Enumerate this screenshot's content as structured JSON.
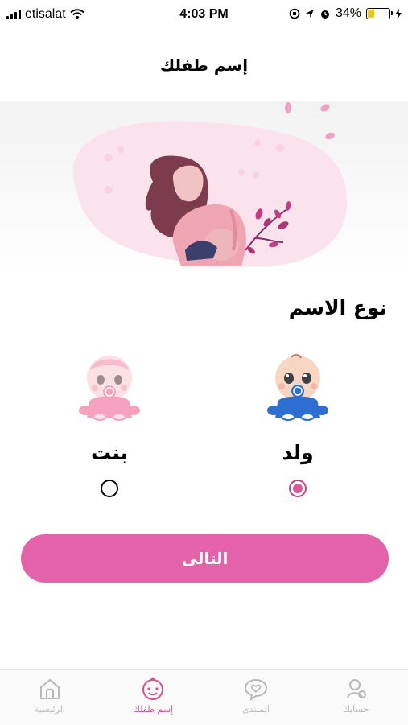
{
  "status_bar": {
    "carrier": "etisalat",
    "time": "4:03 PM",
    "battery": "34%",
    "battery_level": 0.34
  },
  "header": {
    "title": "إسم طفلك"
  },
  "section": {
    "title": "نوع الاسم"
  },
  "options": [
    {
      "label": "ولد",
      "selected": true
    },
    {
      "label": "بنت",
      "selected": false
    }
  ],
  "next_button": {
    "label": "التالى"
  },
  "tabbar": {
    "items": [
      {
        "label": "الرئيسية",
        "icon": "home-icon",
        "active": false
      },
      {
        "label": "إسم طفلك",
        "icon": "baby-face-icon",
        "active": true
      },
      {
        "label": "المنتدى",
        "icon": "chat-heart-icon",
        "active": false
      },
      {
        "label": "حسابك",
        "icon": "account-icon",
        "active": false
      }
    ]
  },
  "colors": {
    "accent": "#e462a9",
    "active_tab": "#d84f95",
    "inactive_tab": "#b8b8b8"
  }
}
